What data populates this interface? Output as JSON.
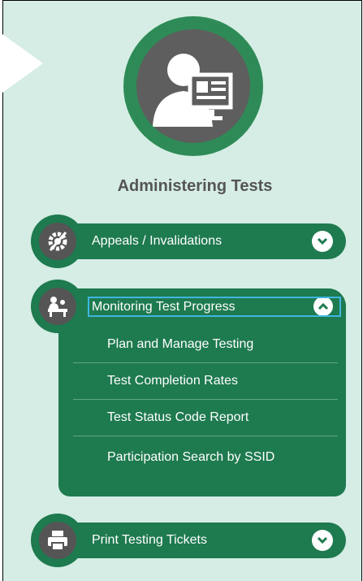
{
  "section": {
    "title": "Administering Tests"
  },
  "menu": {
    "appeals": {
      "label": "Appeals / Invalidations"
    },
    "monitoring": {
      "label": "Monitoring Test Progress",
      "items": [
        {
          "label": "Plan and Manage Testing"
        },
        {
          "label": "Test Completion Rates"
        },
        {
          "label": "Test Status Code Report"
        },
        {
          "label": "Participation Search by SSID"
        }
      ]
    },
    "print": {
      "label": "Print Testing Tickets"
    }
  },
  "colors": {
    "panel_bg": "#d5ede4",
    "brand_green": "#1e7a4f",
    "icon_gray": "#555555",
    "focus_outline": "#3fb6e0"
  },
  "icons": {
    "hero": "user-monitor-icon",
    "appeals": "gear-slash-icon",
    "monitoring": "proctor-desk-icon",
    "print": "printer-icon",
    "expand": "chevron-down-icon",
    "collapse": "chevron-up-icon"
  }
}
